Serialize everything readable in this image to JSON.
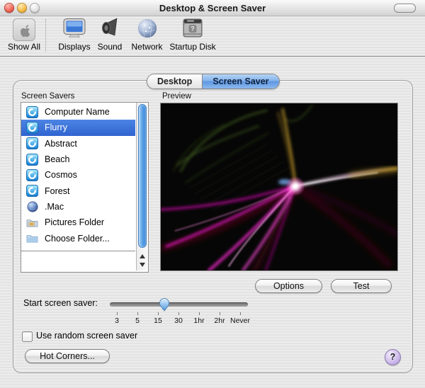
{
  "window": {
    "title": "Desktop & Screen Saver"
  },
  "colors": {
    "selection_blue": "#3B74DC",
    "tab_active_blue": "#78ACEA",
    "scrollbar_blue": "#55A0E6",
    "slider_thumb_blue": "#7DB8EE",
    "help_purple": "#CBB9E9",
    "preview_background": "#060606",
    "close_red": "#EE5F50",
    "minimize_yellow": "#F5B63E"
  },
  "toolbar": {
    "show_all_label": "Show All",
    "items": [
      {
        "label": "Displays",
        "icon": "displays-icon"
      },
      {
        "label": "Sound",
        "icon": "sound-icon"
      },
      {
        "label": "Network",
        "icon": "network-icon"
      },
      {
        "label": "Startup Disk",
        "icon": "startup-disk-icon"
      }
    ]
  },
  "tabs": [
    {
      "label": "Desktop",
      "active": false
    },
    {
      "label": "Screen Saver",
      "active": true
    }
  ],
  "screen_savers": {
    "label": "Screen Savers",
    "items": [
      {
        "name": "Computer Name",
        "icon": "swirl-icon",
        "selected": false
      },
      {
        "name": "Flurry",
        "icon": "swirl-icon",
        "selected": true
      },
      {
        "name": "Abstract",
        "icon": "swirl-icon",
        "selected": false
      },
      {
        "name": "Beach",
        "icon": "swirl-icon",
        "selected": false
      },
      {
        "name": "Cosmos",
        "icon": "swirl-icon",
        "selected": false
      },
      {
        "name": "Forest",
        "icon": "swirl-icon",
        "selected": false
      },
      {
        "name": ".Mac",
        "icon": "globe-icon",
        "selected": false
      },
      {
        "name": "Pictures Folder",
        "icon": "pictures-folder-icon",
        "selected": false
      },
      {
        "name": "Choose Folder...",
        "icon": "folder-icon",
        "selected": false
      }
    ]
  },
  "preview": {
    "label": "Preview"
  },
  "actions": {
    "options_label": "Options",
    "test_label": "Test"
  },
  "slider": {
    "label": "Start screen saver:",
    "ticks": [
      "3",
      "5",
      "15",
      "30",
      "1hr",
      "2hr",
      "Never"
    ],
    "thumb_between": [
      "15",
      "30"
    ],
    "thumb_fraction": 0.4
  },
  "random_checkbox": {
    "label": "Use random screen saver",
    "checked": false
  },
  "footer": {
    "hot_corners_label": "Hot Corners...",
    "help_label": "?"
  }
}
